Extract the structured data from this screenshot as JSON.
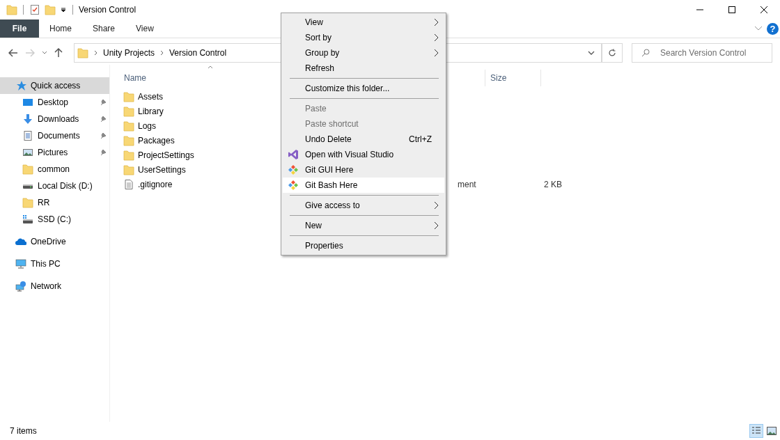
{
  "window": {
    "title": "Version Control"
  },
  "ribbon": {
    "tabs": [
      {
        "label": "File",
        "kind": "file"
      },
      {
        "label": "Home",
        "kind": "tab"
      },
      {
        "label": "Share",
        "kind": "tab"
      },
      {
        "label": "View",
        "kind": "tab"
      }
    ],
    "help_glyph": "?"
  },
  "address": {
    "crumbs": [
      "Unity Projects",
      "Version Control"
    ],
    "search": {
      "placeholder": "Search Version Control"
    }
  },
  "sidebar": {
    "items": [
      {
        "label": "Quick access",
        "kind": "quick",
        "selected": true,
        "children": [
          {
            "label": "Desktop",
            "kind": "desktop",
            "pinned": true,
            "selected": false
          },
          {
            "label": "Downloads",
            "kind": "downloads",
            "pinned": true,
            "selected": false
          },
          {
            "label": "Documents",
            "kind": "documents",
            "pinned": true,
            "selected": false
          },
          {
            "label": "Pictures",
            "kind": "pictures",
            "pinned": true,
            "selected": false
          },
          {
            "label": "common",
            "kind": "folder",
            "pinned": false,
            "selected": false
          },
          {
            "label": "Local Disk (D:)",
            "kind": "drive",
            "pinned": false,
            "selected": false
          },
          {
            "label": "RR",
            "kind": "folder",
            "pinned": false,
            "selected": false
          },
          {
            "label": "SSD (C:)",
            "kind": "system-drive",
            "pinned": false,
            "selected": false
          }
        ]
      },
      {
        "label": "OneDrive",
        "kind": "cloud",
        "selected": false
      },
      {
        "label": "This PC",
        "kind": "pc",
        "selected": false
      },
      {
        "label": "Network",
        "kind": "network",
        "selected": false
      }
    ]
  },
  "file_list": {
    "columns": [
      "Name",
      "Size"
    ],
    "rows": [
      {
        "name": "Assets",
        "kind": "folder"
      },
      {
        "name": "Library",
        "kind": "folder"
      },
      {
        "name": "Logs",
        "kind": "folder"
      },
      {
        "name": "Packages",
        "kind": "folder"
      },
      {
        "name": "ProjectSettings",
        "kind": "folder"
      },
      {
        "name": "UserSettings",
        "kind": "folder"
      },
      {
        "name": ".gitignore",
        "kind": "file",
        "type": "ment",
        "size": "2 KB"
      }
    ]
  },
  "context_menu": {
    "items": [
      {
        "kind": "command",
        "label": "View",
        "submenu": true,
        "disabled": false,
        "selected": false
      },
      {
        "kind": "command",
        "label": "Sort by",
        "submenu": true,
        "disabled": false,
        "selected": false
      },
      {
        "kind": "command",
        "label": "Group by",
        "submenu": true,
        "disabled": false,
        "selected": false
      },
      {
        "kind": "command",
        "label": "Refresh",
        "submenu": false,
        "disabled": false,
        "selected": false
      },
      {
        "kind": "separator"
      },
      {
        "kind": "command",
        "label": "Customize this folder...",
        "submenu": false,
        "disabled": false,
        "selected": false
      },
      {
        "kind": "separator"
      },
      {
        "kind": "command",
        "label": "Paste",
        "submenu": false,
        "disabled": true,
        "selected": false
      },
      {
        "kind": "command",
        "label": "Paste shortcut",
        "submenu": false,
        "disabled": true,
        "selected": false
      },
      {
        "kind": "command",
        "label": "Undo Delete",
        "shortcut": "Ctrl+Z",
        "submenu": false,
        "disabled": false,
        "selected": false
      },
      {
        "kind": "ide-command",
        "label": "Open with Visual Studio",
        "submenu": false,
        "disabled": false,
        "selected": false
      },
      {
        "kind": "git-command",
        "label": "Git GUI Here",
        "submenu": false,
        "disabled": false,
        "selected": false
      },
      {
        "kind": "git-command",
        "label": "Git Bash Here",
        "submenu": false,
        "disabled": false,
        "selected": true
      },
      {
        "kind": "separator"
      },
      {
        "kind": "command",
        "label": "Give access to",
        "submenu": true,
        "disabled": false,
        "selected": false
      },
      {
        "kind": "separator"
      },
      {
        "kind": "command",
        "label": "New",
        "submenu": true,
        "disabled": false,
        "selected": false
      },
      {
        "kind": "separator"
      },
      {
        "kind": "command",
        "label": "Properties",
        "submenu": false,
        "disabled": false,
        "selected": false
      }
    ]
  },
  "status_bar": {
    "count": "7 items"
  }
}
